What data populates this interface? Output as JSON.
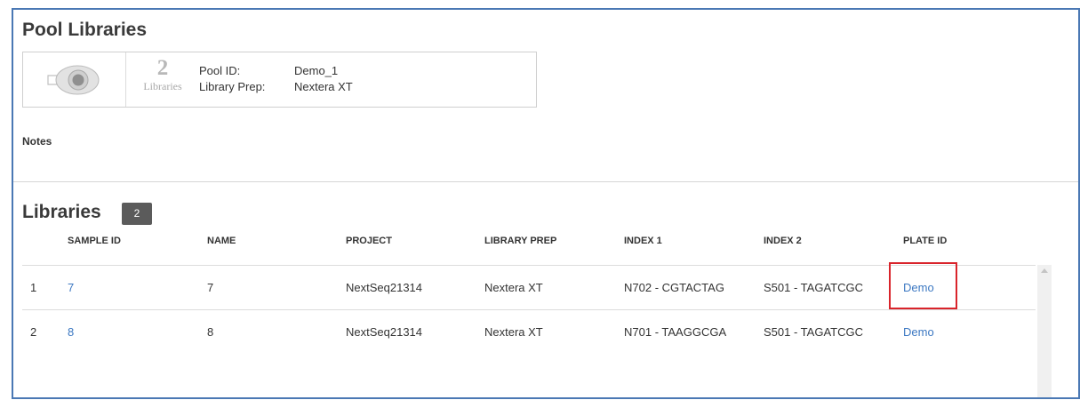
{
  "page": {
    "title": "Pool Libraries"
  },
  "pool": {
    "icon": "pool-tube-icon",
    "library_count": "2",
    "library_count_label": "Libraries",
    "pool_id_label": "Pool ID:",
    "pool_id_value": "Demo_1",
    "library_prep_label": "Library Prep:",
    "library_prep_value": "Nextera XT"
  },
  "notes": {
    "label": "Notes"
  },
  "libraries": {
    "title": "Libraries",
    "count": "2",
    "columns": [
      "SAMPLE ID",
      "NAME",
      "PROJECT",
      "LIBRARY PREP",
      "INDEX 1",
      "INDEX 2",
      "PLATE ID"
    ],
    "rows": [
      {
        "num": "1",
        "sample_id": "7",
        "name": "7",
        "project": "NextSeq21314",
        "library_prep": "Nextera XT",
        "index1": "N702 - CGTACTAG",
        "index2": "S501 - TAGATCGC",
        "plate_id": "Demo"
      },
      {
        "num": "2",
        "sample_id": "8",
        "name": "8",
        "project": "NextSeq21314",
        "library_prep": "Nextera XT",
        "index1": "N701 - TAAGGCGA",
        "index2": "S501 - TAGATCGC",
        "plate_id": "Demo"
      }
    ]
  },
  "colors": {
    "frame_border": "#4a78b4",
    "link": "#3c78c2",
    "badge_bg": "#5b5b5b",
    "highlight": "#d9242b"
  }
}
